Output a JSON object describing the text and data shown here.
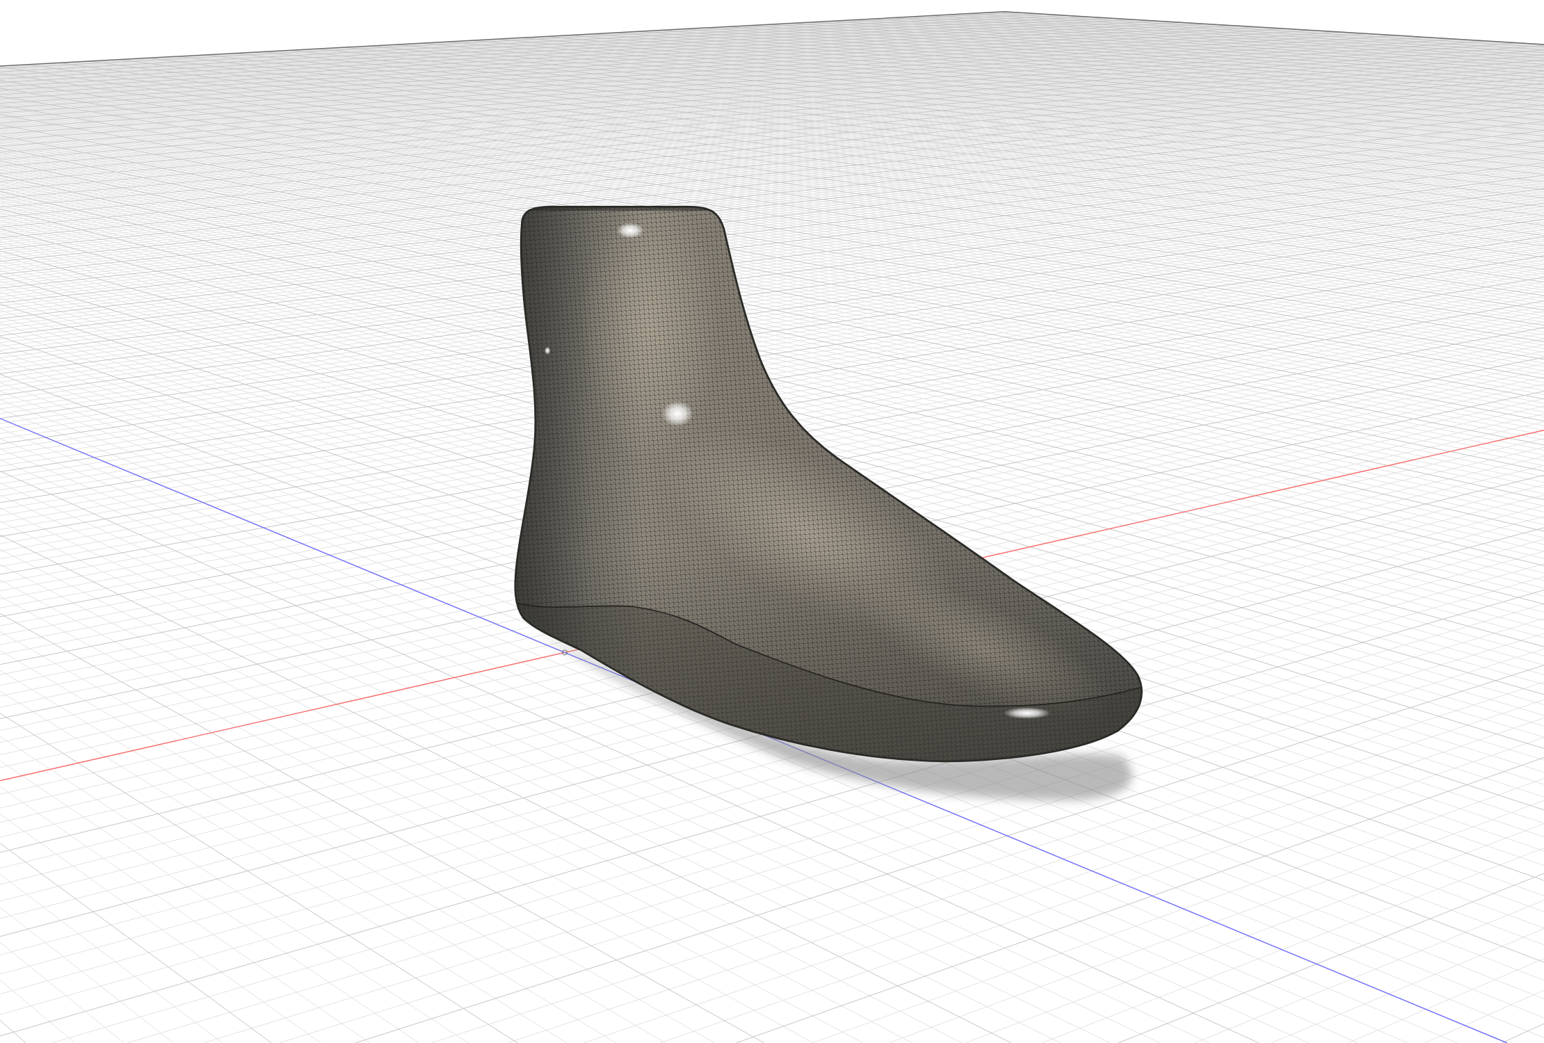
{
  "viewport": {
    "axes": [
      {
        "color": "#ff7070"
      },
      {
        "color": "#7070ff"
      }
    ]
  }
}
